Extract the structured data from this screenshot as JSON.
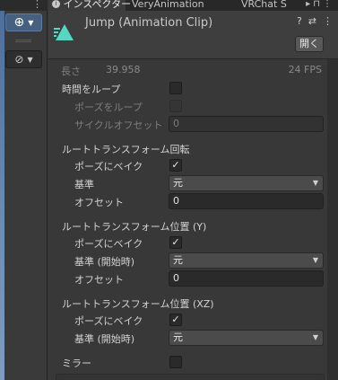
{
  "tabs": {
    "inspector": "インスペクター",
    "veryanimation": "VeryAnimation",
    "vrchat": "VRChat S"
  },
  "header": {
    "clip_title": "Jump (Animation Clip)",
    "open_button": "開く"
  },
  "summary": {
    "length_label": "長さ",
    "length_value": "39.958",
    "fps": "24 FPS"
  },
  "loop_time": {
    "label": "時間をループ",
    "checked": false,
    "loop_pose_label": "ポーズをループ",
    "cycle_offset_label": "サイクルオフセット",
    "cycle_offset_value": "0"
  },
  "root_rotation": {
    "title": "ルートトランスフォーム回転",
    "bake_label": "ポーズにベイク",
    "bake_checked": true,
    "based_upon_label": "基準",
    "based_upon_value": "元",
    "offset_label": "オフセット",
    "offset_value": "0"
  },
  "root_position_y": {
    "title": "ルートトランスフォーム位置 (Y)",
    "bake_label": "ポーズにベイク",
    "bake_checked": true,
    "based_upon_label": "基準 (開始時)",
    "based_upon_value": "元",
    "offset_label": "オフセット",
    "offset_value": "0"
  },
  "root_position_xz": {
    "title": "ルートトランスフォーム位置 (XZ)",
    "bake_label": "ポーズにベイク",
    "bake_checked": true,
    "based_upon_label": "基準 (開始時)",
    "based_upon_value": "元"
  },
  "mirror": {
    "label": "ミラー",
    "checked": false
  },
  "checkmark": "✓",
  "dropdown_arrow": "▼",
  "colors": {
    "panel_bg": "#383838",
    "field_bg": "#2a2a2a",
    "dropdown_bg": "#4b4b4b",
    "clip_icon": "#57d6c2",
    "scene_tool_active": "#46607f"
  },
  "icons": {
    "inspector_tab": "info-icon",
    "clip": "animation-clip-icon",
    "help": "help-icon",
    "settings": "preset-settings-icon",
    "menu": "kebab-menu-icon",
    "gizmo": "move-gizmo-icon",
    "compass": "compass-icon"
  }
}
